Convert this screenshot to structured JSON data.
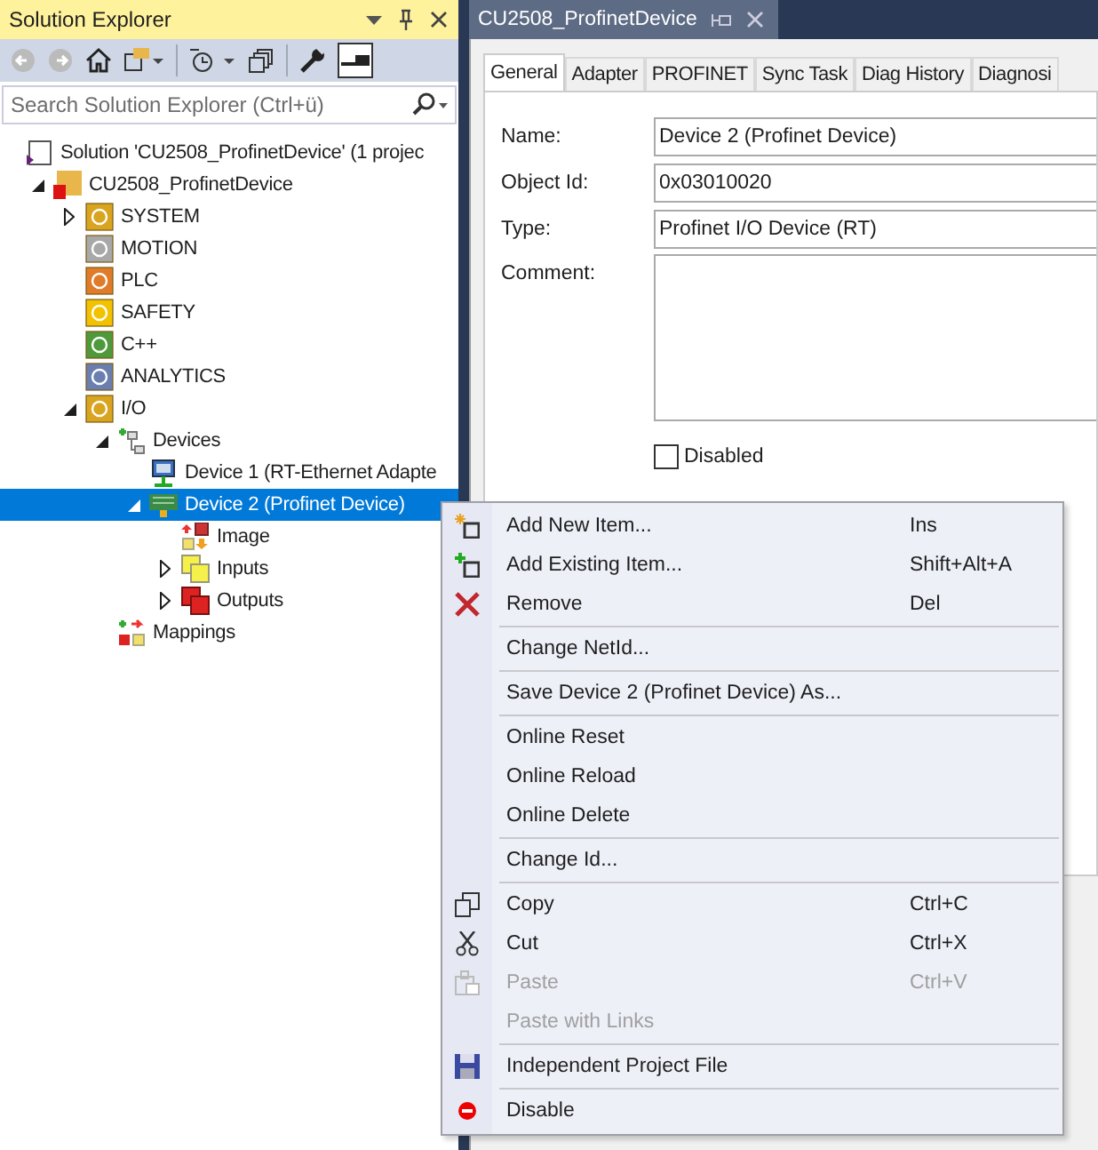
{
  "explorer": {
    "title": "Solution Explorer",
    "search": {
      "placeholder": "Search Solution Explorer (Ctrl+ü)"
    },
    "tree": {
      "label": "Solution 'CU2508_ProfinetDevice' (1 projec",
      "kind": "solution",
      "selected": false,
      "children": [
        {
          "label": "CU2508_ProfinetDevice",
          "kind": "project",
          "selected": false,
          "expanded": true,
          "children": [
            {
              "label": "SYSTEM",
              "kind": "system",
              "selected": false,
              "expanded": false
            },
            {
              "label": "MOTION",
              "kind": "motion",
              "selected": false
            },
            {
              "label": "PLC",
              "kind": "plc",
              "selected": false
            },
            {
              "label": "SAFETY",
              "kind": "safety",
              "selected": false
            },
            {
              "label": "C++",
              "kind": "cpp",
              "selected": false
            },
            {
              "label": "ANALYTICS",
              "kind": "analytics",
              "selected": false
            },
            {
              "label": "I/O",
              "kind": "io",
              "selected": false,
              "expanded": true,
              "children": [
                {
                  "label": "Devices",
                  "kind": "devices",
                  "selected": false,
                  "expanded": true,
                  "children": [
                    {
                      "label": "Device 1 (RT-Ethernet Adapte",
                      "kind": "adapter",
                      "selected": false
                    },
                    {
                      "label": "Device 2 (Profinet Device)",
                      "kind": "profinet",
                      "selected": true,
                      "expanded": true,
                      "children": [
                        {
                          "label": "Image",
                          "kind": "image",
                          "selected": false
                        },
                        {
                          "label": "Inputs",
                          "kind": "inputs",
                          "selected": false,
                          "expanded": false
                        },
                        {
                          "label": "Outputs",
                          "kind": "outputs",
                          "selected": false,
                          "expanded": false
                        }
                      ]
                    }
                  ]
                },
                {
                  "label": "Mappings",
                  "kind": "mappings",
                  "selected": false
                }
              ]
            }
          ]
        }
      ]
    }
  },
  "document": {
    "tab": "CU2508_ProfinetDevice",
    "tabs": [
      {
        "label": "General",
        "selected": true
      },
      {
        "label": "Adapter",
        "selected": false
      },
      {
        "label": "PROFINET",
        "selected": false
      },
      {
        "label": "Sync Task",
        "selected": false
      },
      {
        "label": "Diag History",
        "selected": false
      },
      {
        "label": "Diagnosi",
        "selected": false
      }
    ],
    "fields": [
      {
        "label": "Name:",
        "value": "Device 2 (Profinet Device)",
        "kind": "line"
      },
      {
        "label": "Object Id:",
        "value": "0x03010020",
        "kind": "line"
      },
      {
        "label": "Type:",
        "value": "Profinet I/O Device (RT)",
        "kind": "line"
      },
      {
        "label": "Comment:",
        "kind": "area"
      }
    ],
    "disabled": {
      "label": "Disabled",
      "checked": false
    }
  },
  "context_menu": [
    [
      {
        "label": "Add New Item...",
        "shortcut": "Ins",
        "kind": "new",
        "disabled": false
      },
      {
        "label": "Add Existing Item...",
        "shortcut": "Shift+Alt+A",
        "kind": "existing",
        "disabled": false
      },
      {
        "label": "Remove",
        "shortcut": "Del",
        "kind": "remove",
        "disabled": false
      }
    ],
    [
      {
        "label": "Change NetId...",
        "disabled": false
      }
    ],
    [
      {
        "label": "Save Device 2 (Profinet Device) As...",
        "disabled": false
      }
    ],
    [
      {
        "label": "Online Reset",
        "disabled": false
      },
      {
        "label": "Online Reload",
        "disabled": false
      },
      {
        "label": "Online Delete",
        "disabled": false
      }
    ],
    [
      {
        "label": "Change Id...",
        "disabled": false
      }
    ],
    [
      {
        "label": "Copy",
        "shortcut": "Ctrl+C",
        "kind": "copy",
        "disabled": false
      },
      {
        "label": "Cut",
        "shortcut": "Ctrl+X",
        "kind": "cut",
        "disabled": false
      },
      {
        "label": "Paste",
        "shortcut": "Ctrl+V",
        "kind": "paste",
        "disabled": true
      },
      {
        "label": "Paste with Links",
        "disabled": true
      }
    ],
    [
      {
        "label": "Independent Project File",
        "kind": "save",
        "disabled": false
      }
    ],
    [
      {
        "label": "Disable",
        "kind": "disable",
        "disabled": false
      }
    ]
  ]
}
